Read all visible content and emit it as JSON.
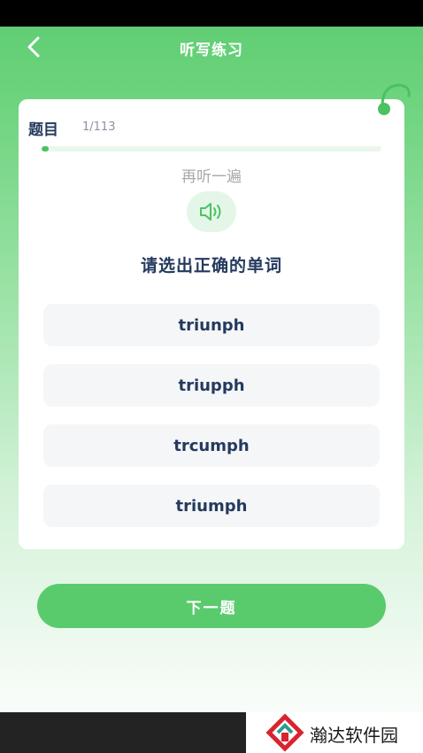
{
  "header": {
    "title": "听写练习"
  },
  "question": {
    "label": "题目",
    "counter": "1/113",
    "progress_fraction": 0.009,
    "replay_label": "再听一遍",
    "prompt": "请选出正确的单词"
  },
  "options": [
    {
      "text": "triunph"
    },
    {
      "text": "triupph"
    },
    {
      "text": "trcumph"
    },
    {
      "text": "triumph"
    }
  ],
  "next_button": {
    "label": "下一题"
  },
  "watermark": {
    "text": "瀚达软件园"
  },
  "colors": {
    "primary_green": "#5acb6d",
    "text_dark": "#243a5e",
    "option_bg": "#f5f6f8"
  }
}
